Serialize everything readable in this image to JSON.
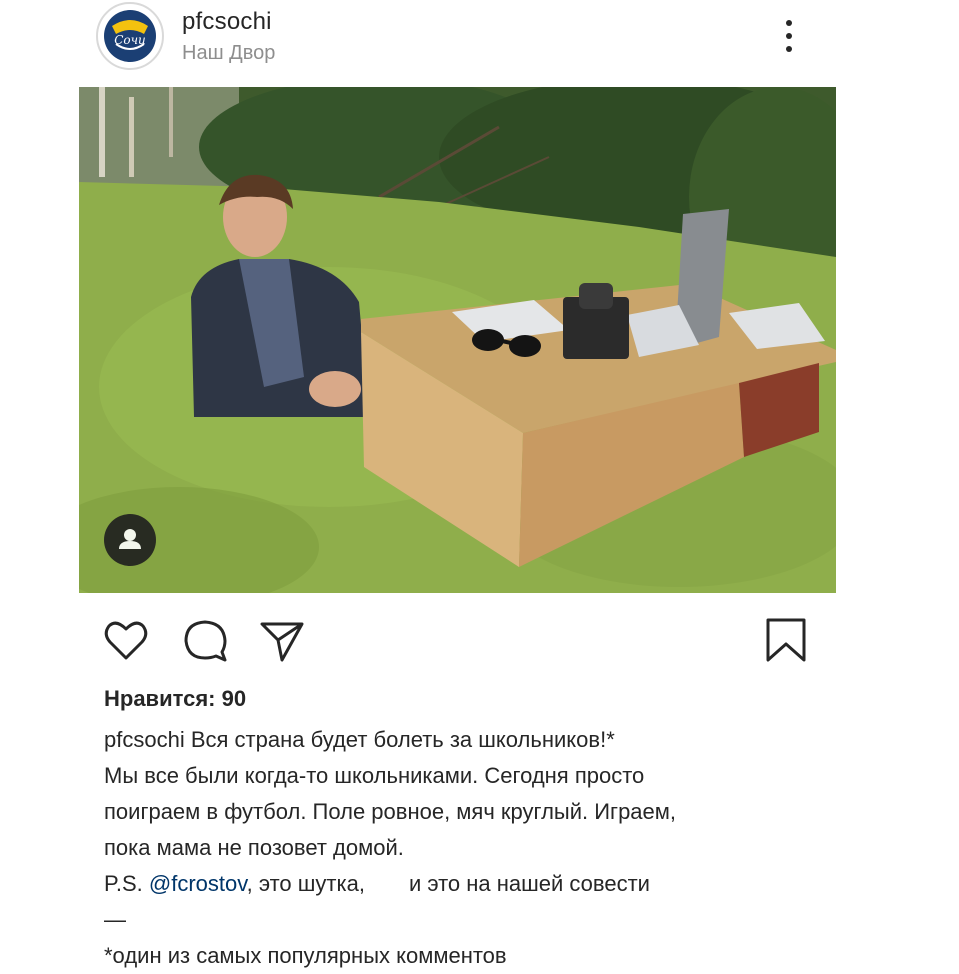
{
  "post": {
    "username": "pfcsochi",
    "location": "Наш Двор",
    "avatar_text": "Сочи"
  },
  "icons": {
    "avatar": "club-logo-icon",
    "more": "more-options-icon",
    "tag": "user-tag-icon",
    "like": "heart-icon",
    "comment": "comment-icon",
    "share": "send-icon",
    "save": "bookmark-icon"
  },
  "likes": "Нравится: 90",
  "caption": {
    "username": "pfcsochi",
    "first_line": "Вся страна будет болеть за школьников!*",
    "lines": [
      "Мы все были когда-то школьниками. Сегодня просто",
      "поиграем в футбол. Поле ровное, мяч круглый. Играем,",
      "пока мама не позовет домой."
    ],
    "ps_prefix": "P.S.",
    "mention": "@fcrostov",
    "ps_middle": ", это шутка,",
    "ps_end": "и это на нашей совести",
    "dash": "—",
    "footnote": "*один из самых популярных комментов"
  },
  "colors": {
    "text": "#262626",
    "secondary": "#8e8e8e",
    "mention": "#003569",
    "water": "#8fae4b"
  }
}
